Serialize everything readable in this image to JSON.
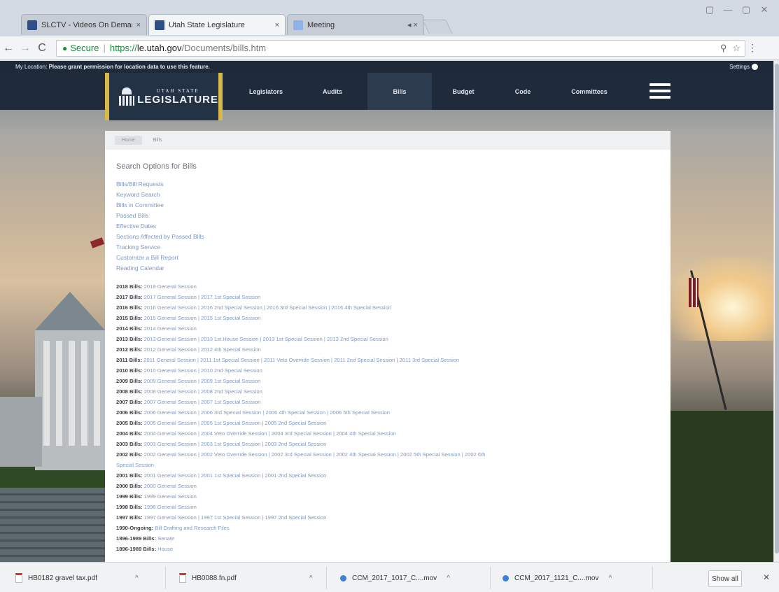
{
  "browser": {
    "tabs": [
      {
        "label": "SLCTV - Videos On Deman",
        "close": "×"
      },
      {
        "label": "Utah State Legislature",
        "close": "×"
      },
      {
        "label": "Meeting",
        "close": "◂ ×"
      }
    ],
    "window_controls": [
      "▢",
      "—",
      "▢",
      "✕"
    ],
    "nav": {
      "back": "←",
      "forward": "→",
      "reload": "C"
    },
    "secure_label": "Secure",
    "url_scheme": "https://",
    "url_host": "le.utah.gov",
    "url_path": "/Documents/bills.htm",
    "omni_icons": [
      "⚲",
      "☆"
    ],
    "menu": "⋮"
  },
  "site": {
    "location_prefix": "My Location:",
    "location_message": "Please grant permission for location data to use this feature.",
    "settings_label": "Settings",
    "logo_small": "UTAH STATE",
    "logo_big": "LEGISLATURE",
    "nav": [
      "Legislators",
      "Audits",
      "Bills",
      "Budget",
      "Code",
      "Committees"
    ]
  },
  "content": {
    "breadcrumbs": [
      "Home",
      "Bills"
    ],
    "search_title": "Search Options for Bills",
    "options": [
      "Bills/Bill Requests",
      "Keyword Search",
      "Bills in Committee",
      "Passed Bills",
      "Effective Dates",
      "Sections Affected by Passed Bills",
      "Tracking Service",
      "Customize a Bill Report",
      "Reading Calendar"
    ],
    "sessions": [
      {
        "year": "2018 Bills:",
        "links": "2018 General Session"
      },
      {
        "year": "2017 Bills:",
        "links": "2017 General Session | 2017 1st Special Session"
      },
      {
        "year": "2016 Bills:",
        "links": "2016 General Session | 2016 2nd Special Session | 2016 3rd Special Session | 2016 4th Special Session"
      },
      {
        "year": "2015 Bills:",
        "links": "2015 General Session | 2015 1st Special Session"
      },
      {
        "year": "2014 Bills:",
        "links": "2014 General Session"
      },
      {
        "year": "2013 Bills:",
        "links": "2013 General Session | 2013 1st House Session | 2013 1st Special Session | 2013 2nd Special Session"
      },
      {
        "year": "2012 Bills:",
        "links": "2012 General Session | 2012 4th Special Session"
      },
      {
        "year": "2011 Bills:",
        "links": "2011 General Session | 2011 1st Special Session | 2011 Veto Override Session | 2011 2nd Special Session | 2011 3rd Special Session"
      },
      {
        "year": "2010 Bills:",
        "links": "2010 General Session | 2010 2nd Special Session"
      },
      {
        "year": "2009 Bills:",
        "links": "2009 General Session | 2009 1st Special Session"
      },
      {
        "year": "2008 Bills:",
        "links": "2008 General Session | 2008 2nd Special Session"
      },
      {
        "year": "2007 Bills:",
        "links": "2007 General Session | 2007 1st Special Session"
      },
      {
        "year": "2006 Bills:",
        "links": "2006 General Session | 2006 3rd Special Session | 2006 4th Special Session | 2006 5th Special Session"
      },
      {
        "year": "2005 Bills:",
        "links": "2005 General Session | 2005 1st Special Session | 2005 2nd Special Session"
      },
      {
        "year": "2004 Bills:",
        "links": "2004 General Session | 2004 Veto Override Session | 2004 3rd Special Session | 2004 4th Special Session"
      },
      {
        "year": "2003 Bills:",
        "links": "2003 General Session | 2003 1st Special Session | 2003 2nd Special Session"
      },
      {
        "year": "2002 Bills:",
        "links": "2002 General Session | 2002 Veto Override Session | 2002 3rd Special Session | 2002 4th Special Session | 2002 5th Special Session | 2002 6th"
      },
      {
        "year": "",
        "links": "Special Session"
      },
      {
        "year": "2001 Bills:",
        "links": "2001 General Session | 2001 1st Special Session | 2001 2nd Special Session"
      },
      {
        "year": "2000 Bills:",
        "links": "2000 General Session"
      },
      {
        "year": "1999 Bills:",
        "links": "1999 General Session"
      },
      {
        "year": "1998 Bills:",
        "links": "1998 General Session"
      },
      {
        "year": "1997 Bills:",
        "links": "1997 General Session | 1997 1st Special Session | 1997 2nd Special Session"
      },
      {
        "year": "1990-Ongoing:",
        "links": "Bill Drafting and Research Files"
      },
      {
        "year": "1896-1989 Bills:",
        "links": "Senate"
      },
      {
        "year": "1896-1989 Bills:",
        "links": "House"
      }
    ]
  },
  "downloads": {
    "items": [
      {
        "name": "HB0182 gravel tax.pdf",
        "type": "pdf"
      },
      {
        "name": "HB0088.fn.pdf",
        "type": "pdf"
      },
      {
        "name": "CCM_2017_1017_C....mov",
        "type": "mov"
      },
      {
        "name": "CCM_2017_1121_C....mov",
        "type": "mov"
      }
    ],
    "caret": "^",
    "show_all": "Show all",
    "close": "✕"
  }
}
